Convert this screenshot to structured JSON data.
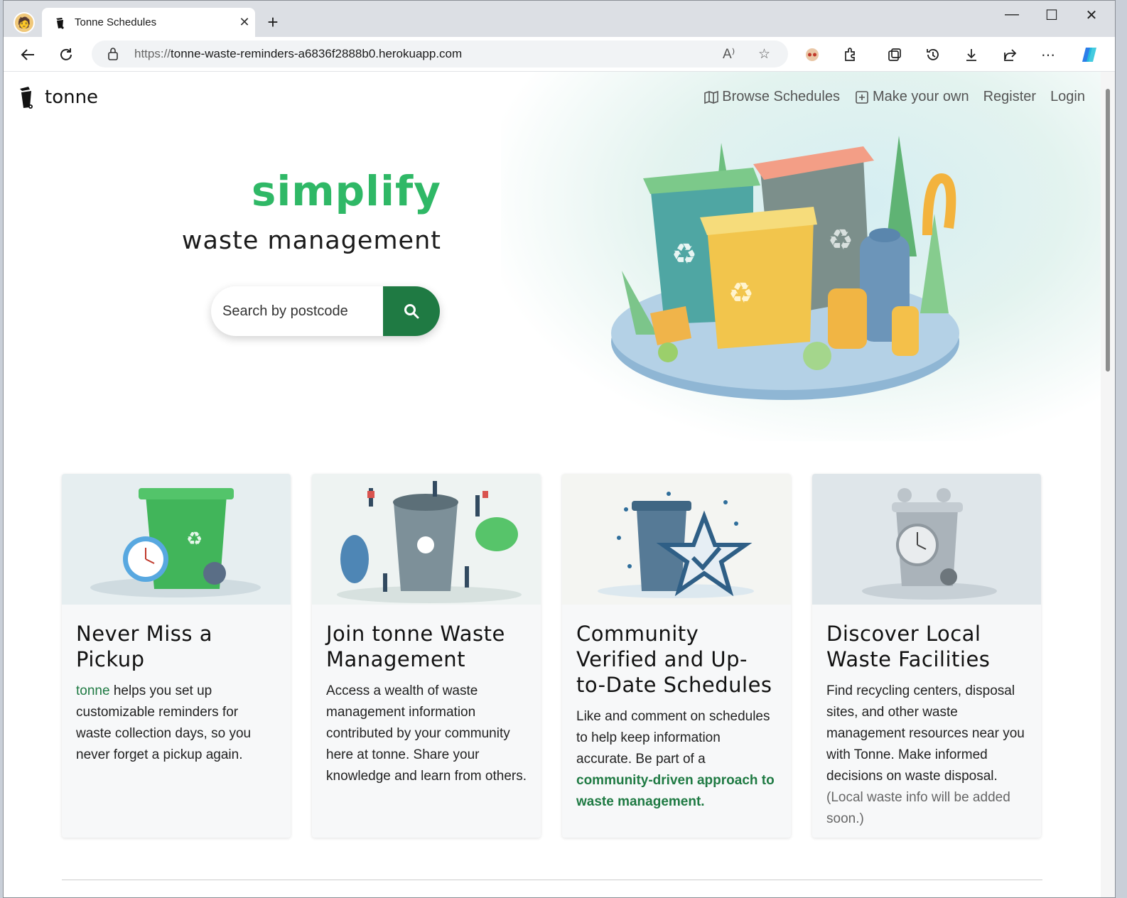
{
  "browser": {
    "tab_title": "Tonne Schedules",
    "url_protocol": "https://",
    "url_host": "tonne-waste-reminders-a6836f2888b0.herokuapp.com",
    "read_aloud_label": "A⁾"
  },
  "header": {
    "brand": "tonne",
    "nav": {
      "browse": "Browse Schedules",
      "make": "Make your own",
      "register": "Register",
      "login": "Login"
    }
  },
  "hero": {
    "title": "simplify",
    "subtitle": "waste management",
    "search_placeholder": "Search by postcode"
  },
  "cards": [
    {
      "title": "Never Miss a Pickup",
      "brand_word": "tonne",
      "text": " helps you set up customizable reminders for waste collection days, so you never forget a pickup again."
    },
    {
      "title": "Join tonne Waste Management",
      "text": "Access a wealth of waste management information contributed by your community here at tonne. Share your knowledge and learn from others."
    },
    {
      "title": "Community Verified and Up-to-Date Schedules",
      "text": "Like and comment on schedules to help keep information accurate. Be part of a ",
      "highlight": "community-driven approach to waste management."
    },
    {
      "title": "Discover Local Waste Facilities",
      "text": "Find recycling centers, disposal sites, and other waste management resources near you with Tonne. Make informed decisions on waste disposal.",
      "note": "(Local waste info will be added soon.)"
    }
  ],
  "colors": {
    "accent_green": "#2fb866",
    "button_green": "#1f7a43"
  }
}
